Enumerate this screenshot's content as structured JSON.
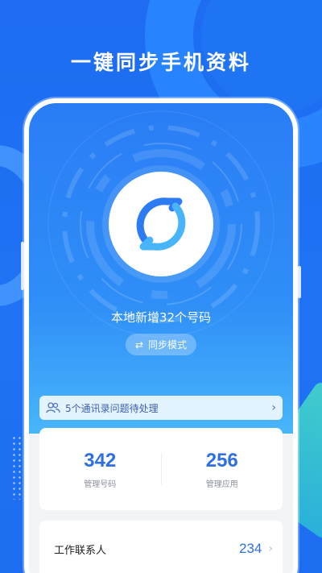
{
  "headline": "一键同步手机资料",
  "sync": {
    "local_added_text": "本地新增32个号码",
    "mode_button_label": "同步模式"
  },
  "notice": {
    "text": "5个通讯录问题待处理"
  },
  "stats": [
    {
      "value": "342",
      "caption": "管理号码"
    },
    {
      "value": "256",
      "caption": "管理应用"
    }
  ],
  "contacts_row": {
    "label": "工作联系人",
    "value": "234"
  },
  "colors": {
    "brand_blue": "#1f6ff0",
    "accent_number": "#2e6fe6"
  },
  "icons": {
    "sync": "sync-arrows-icon",
    "swap": "swap-icon",
    "people": "contacts-icon",
    "chevron": "chevron-right-icon"
  }
}
